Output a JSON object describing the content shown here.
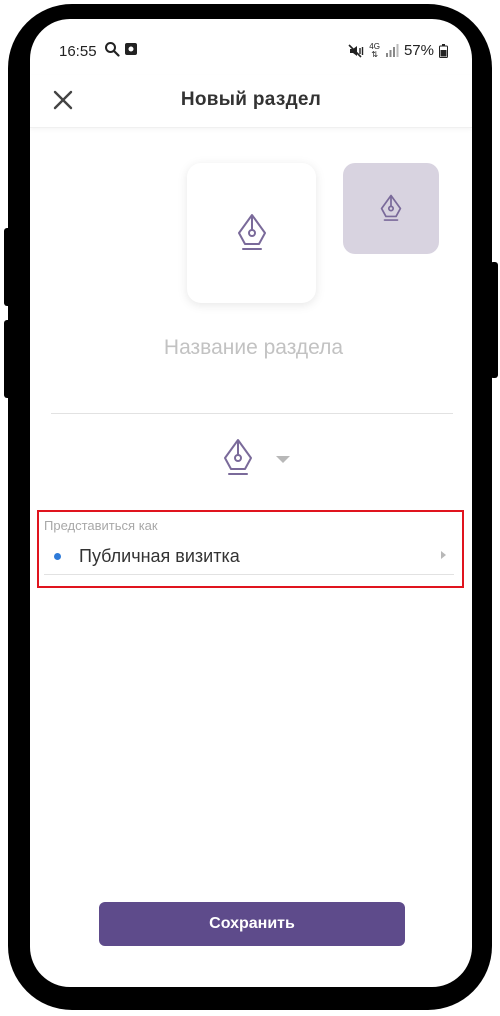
{
  "status_bar": {
    "time": "16:55",
    "left_icons": [
      "search-icon",
      "screenshot-icon"
    ],
    "right_icons": [
      "mute-vibrate-icon",
      "4g-icon",
      "signal-icon",
      "battery-icon"
    ],
    "network": "4G",
    "battery": "57%"
  },
  "header": {
    "title": "Новый раздел",
    "close_icon": "close-icon"
  },
  "tiles": {
    "main_icon": "fountain-pen-icon",
    "alt_icon": "fountain-pen-icon"
  },
  "section_name": {
    "placeholder": "Название раздела",
    "value": ""
  },
  "icon_picker": {
    "icon": "fountain-pen-icon",
    "dropdown_icon": "caret-down-icon"
  },
  "present_as": {
    "label": "Представиться как",
    "value": "Публичная визитка"
  },
  "actions": {
    "save_label": "Сохранить"
  },
  "colors": {
    "accent": "#5e4b8b",
    "icon_stroke": "#7a6a9a",
    "alt_tile_bg": "#d8d3e0",
    "highlight_border": "#e0141e",
    "dot": "#2e7bd9"
  }
}
